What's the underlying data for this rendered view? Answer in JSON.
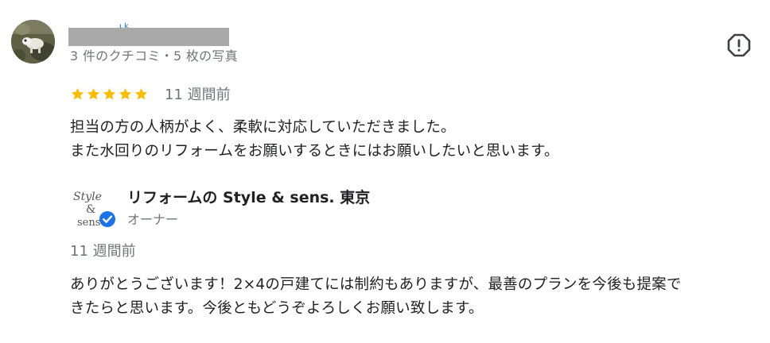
{
  "reviewer": {
    "meta": "3 件のクチコミ・5 枚の写真"
  },
  "review": {
    "rating": 5,
    "rating_max": 5,
    "star_color": "#fbbc04",
    "date": "11 週間前",
    "lines": [
      "担当の方の人柄がよく、柔軟に対応していただきました。",
      "また水回りのリフォームをお願いするときにはお願いしたいと思います。"
    ]
  },
  "owner_reply": {
    "logo_text": [
      "Style",
      "&",
      "sens"
    ],
    "name": "リフォームの Style & sens. 東京",
    "role": "オーナー",
    "verified_color": "#1a73e8",
    "date": "11 週間前",
    "lines": [
      "ありがとうございます！2×4の戸建てには制約もありますが、最善のプランを今後も提案で",
      "きたらと思います。今後ともどうぞよろしくお願い致します。"
    ]
  },
  "icons": {
    "report": "report-flag-icon",
    "star": "star-icon",
    "verified": "verified-badge-icon"
  }
}
